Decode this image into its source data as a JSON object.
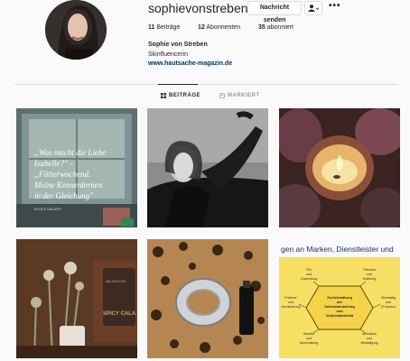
{
  "profile": {
    "username": "sophievonstreben",
    "message_button": "Nachricht senden",
    "more_glyph": "•••",
    "stats": [
      {
        "count": "11",
        "label": "Beiträge"
      },
      {
        "count": "12",
        "label": "Abonnenten"
      },
      {
        "count": "35",
        "label": "abonniert"
      }
    ],
    "full_name": "Sophie von Streben",
    "category": "Skinfluencerin",
    "website": "www.hautsache-magazin.de"
  },
  "tabs": [
    {
      "label": "BEITRÄGE",
      "icon": "grid-icon",
      "active": true
    },
    {
      "label": "MARKIERT",
      "icon": "tag-icon",
      "active": false
    }
  ],
  "posts": {
    "quote_lines": [
      "„Was macht die Liebe",
      "Isabelle?\" –",
      "„Flitterwochend.",
      "Meine Kennenlernen",
      "in der Gleichung\""
    ],
    "quote_credit": "ISTOCK GALLERY",
    "diagram_header": "gen an Marken, Dienstleister und",
    "diagram_center": [
      "Zurückhaltung",
      "der",
      "Selbstdarstellung",
      "und",
      "Verkleidaktivität"
    ],
    "diagram_labels": [
      [
        "Frei",
        "und",
        "Zuwendung"
      ],
      [
        "Träumen",
        "und",
        "Hoffnung"
      ],
      [
        "Präsenz",
        "und",
        "Vereinbarung"
      ],
      [
        "Sinnhaftig",
        "und",
        "(Purpose)"
      ],
      [
        "Struktur",
        "und",
        "Unterhaltung"
      ],
      [
        "Animation",
        "und",
        "Bestätigung"
      ]
    ],
    "shop_sign": "SPICY CALA",
    "sign_top": "MILLION LIVES"
  },
  "colors": {
    "accent_link": "#003569",
    "diagram_bg": "#f7df64"
  }
}
